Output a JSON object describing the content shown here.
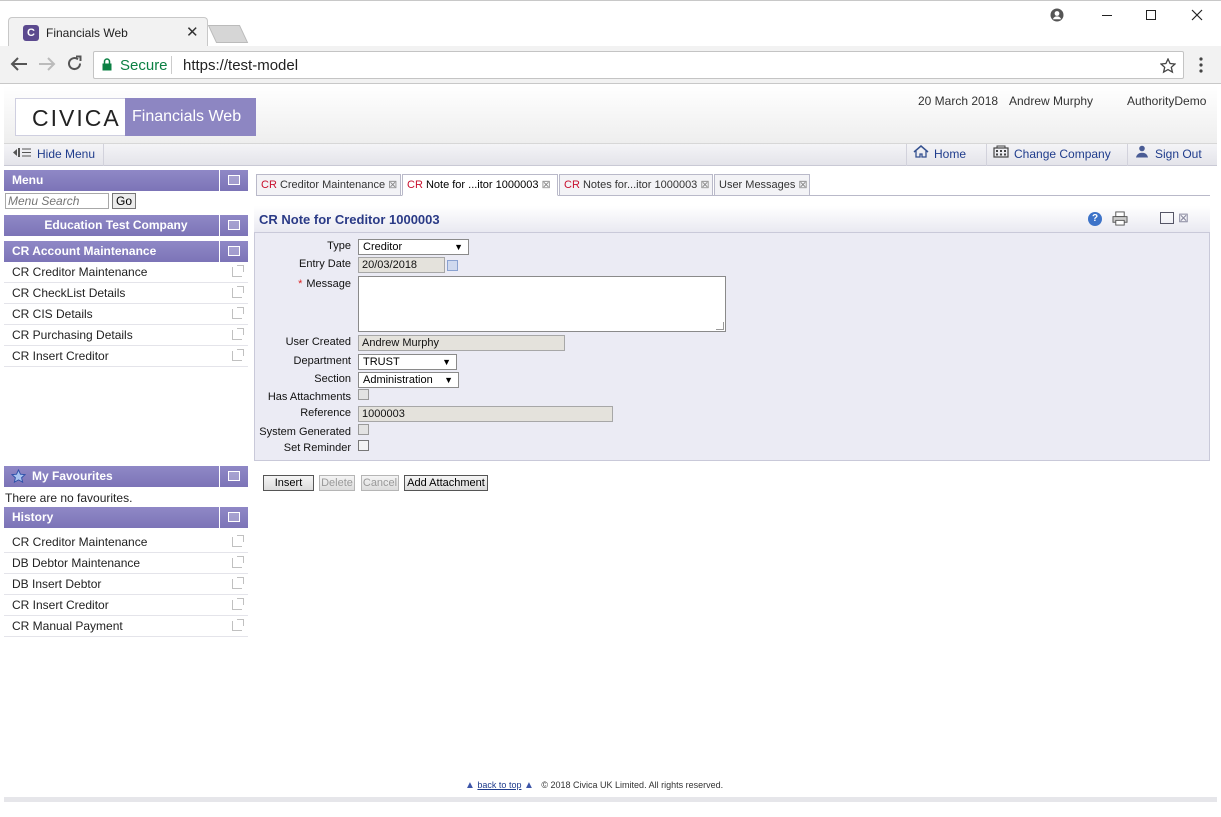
{
  "browser": {
    "tab_title": "Financials Web",
    "tab_close": "✕",
    "favicon": "C",
    "secure_label": "Secure",
    "url": "https://test-model"
  },
  "header": {
    "logo_text": "CIVICA",
    "product_name": "Financials Web",
    "date": "20 March 2018",
    "user": "Andrew Murphy",
    "authority": "AuthorityDemo"
  },
  "menubar": {
    "hide_menu": "Hide Menu",
    "home": "Home",
    "change_company": "Change Company",
    "sign_out": "Sign Out"
  },
  "sidebar": {
    "menu_title": "Menu",
    "search_placeholder": "Menu Search",
    "go_label": "Go",
    "company": "Education Test Company",
    "section_title": "CR Account Maintenance",
    "items": [
      {
        "label": "CR Creditor Maintenance"
      },
      {
        "label": "CR CheckList Details"
      },
      {
        "label": "CR CIS Details"
      },
      {
        "label": "CR Purchasing Details"
      },
      {
        "label": "CR Insert Creditor"
      }
    ],
    "favourites_title": "My Favourites",
    "favourites_empty": "There are no favourites.",
    "history_title": "History",
    "history": [
      {
        "label": "CR Creditor Maintenance"
      },
      {
        "label": "DB Debtor Maintenance"
      },
      {
        "label": "DB Insert Debtor"
      },
      {
        "label": "CR Insert Creditor"
      },
      {
        "label": "CR Manual Payment"
      }
    ]
  },
  "tabs": [
    {
      "prefix": "CR",
      "label": "Creditor Maintenance",
      "active": false
    },
    {
      "prefix": "CR",
      "label": "Note for ...itor 1000003",
      "active": true
    },
    {
      "prefix": "CR",
      "label": "Notes for...itor 1000003",
      "active": false
    },
    {
      "prefix": "",
      "label": "User Messages",
      "active": false
    }
  ],
  "form": {
    "title": "CR Note for Creditor 1000003",
    "help": "?",
    "fields": {
      "type_label": "Type",
      "type_value": "Creditor",
      "entry_date_label": "Entry Date",
      "entry_date_value": "20/03/2018",
      "message_label": "Message",
      "required_mark": "*",
      "user_created_label": "User Created",
      "user_created_value": "Andrew Murphy",
      "department_label": "Department",
      "department_value": "TRUST",
      "section_label": "Section",
      "section_value": "Administration",
      "has_attachments_label": "Has Attachments",
      "reference_label": "Reference",
      "reference_value": "1000003",
      "system_generated_label": "System Generated",
      "set_reminder_label": "Set Reminder"
    },
    "buttons": {
      "insert": "Insert",
      "delete": "Delete",
      "cancel": "Cancel",
      "add_attachment": "Add Attachment"
    }
  },
  "footer": {
    "back_to_top": "back to top",
    "copyright": "© 2018 Civica UK Limited. All rights reserved."
  }
}
